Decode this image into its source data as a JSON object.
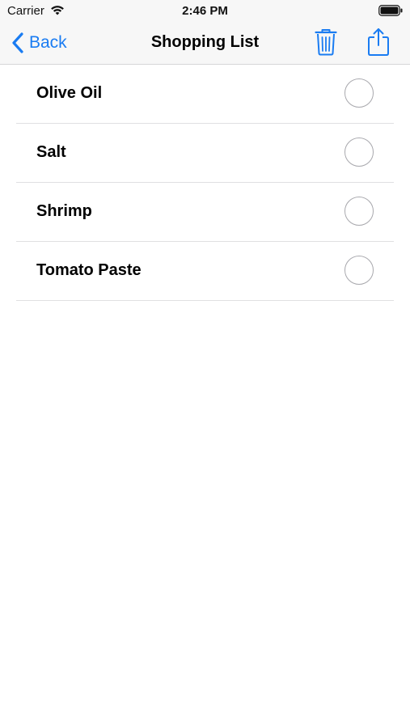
{
  "status_bar": {
    "carrier": "Carrier",
    "time": "2:46 PM",
    "wifi_icon": "wifi-icon",
    "battery_icon": "battery-icon"
  },
  "nav": {
    "back_label": "Back",
    "title": "Shopping List",
    "trash_icon": "trash-icon",
    "share_icon": "share-icon",
    "accent_color": "#1a7cf2"
  },
  "items": [
    {
      "label": "Olive Oil",
      "checked": false
    },
    {
      "label": "Salt",
      "checked": false
    },
    {
      "label": "Shrimp",
      "checked": false
    },
    {
      "label": "Tomato Paste",
      "checked": false
    }
  ]
}
